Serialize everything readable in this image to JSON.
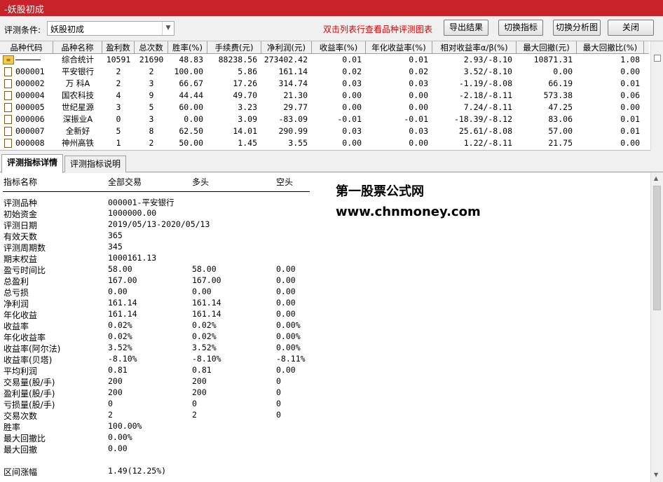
{
  "window": {
    "title": "-妖股初成"
  },
  "toolbar": {
    "condition_label": "评测条件:",
    "condition_value": "妖股初成",
    "hint": "双击列表行查看品种评测图表",
    "export_label": "导出结果",
    "switch_indicator_label": "切换指标",
    "switch_chart_label": "切换分析图",
    "close_label": "关闭"
  },
  "table": {
    "headers": [
      "品种代码",
      "品种名称",
      "盈利数",
      "总次数",
      "胜率(%)",
      "手续费(元)",
      "净利润(元)",
      "收益率(%)",
      "年化收益率(%)",
      "相对收益率α/β(%)",
      "最大回撤(元)",
      "最大回撤比(%)"
    ],
    "rows": [
      [
        "",
        "综合统计",
        "10591",
        "21690",
        "48.83",
        "88238.56",
        "273402.42",
        "0.01",
        "0.01",
        "2.93/-8.10",
        "10871.31",
        "1.08"
      ],
      [
        "000001",
        "平安银行",
        "2",
        "2",
        "100.00",
        "5.86",
        "161.14",
        "0.02",
        "0.02",
        "3.52/-8.10",
        "0.00",
        "0.00"
      ],
      [
        "000002",
        "万 科A",
        "2",
        "3",
        "66.67",
        "17.26",
        "314.74",
        "0.03",
        "0.03",
        "-1.19/-8.08",
        "66.19",
        "0.01"
      ],
      [
        "000004",
        "国农科技",
        "4",
        "9",
        "44.44",
        "49.70",
        "21.30",
        "0.00",
        "0.00",
        "-2.18/-8.11",
        "573.38",
        "0.06"
      ],
      [
        "000005",
        "世纪星源",
        "3",
        "5",
        "60.00",
        "3.23",
        "29.77",
        "0.00",
        "0.00",
        "7.24/-8.11",
        "47.25",
        "0.00"
      ],
      [
        "000006",
        "深振业A",
        "0",
        "3",
        "0.00",
        "3.09",
        "-83.09",
        "-0.01",
        "-0.01",
        "-18.39/-8.12",
        "83.06",
        "0.01"
      ],
      [
        "000007",
        "全新好",
        "5",
        "8",
        "62.50",
        "14.01",
        "290.99",
        "0.03",
        "0.03",
        "25.61/-8.08",
        "57.00",
        "0.01"
      ],
      [
        "000008",
        "神州高铁",
        "1",
        "2",
        "50.00",
        "1.45",
        "3.55",
        "0.00",
        "0.00",
        "1.22/-8.11",
        "21.75",
        "0.00"
      ]
    ]
  },
  "tabs": {
    "detail": "评测指标详情",
    "explain": "评测指标说明"
  },
  "detail": {
    "headers": {
      "name": "指标名称",
      "all": "全部交易",
      "long": "多头",
      "short": "空头"
    },
    "items": [
      {
        "label": "评测品种",
        "all": "000001-平安银行",
        "long": "",
        "short": ""
      },
      {
        "label": "初始资金",
        "all": "1000000.00",
        "long": "",
        "short": ""
      },
      {
        "label": "评测日期",
        "all": "2019/05/13-2020/05/13",
        "long": "",
        "short": ""
      },
      {
        "label": "有效天数",
        "all": "365",
        "long": "",
        "short": ""
      },
      {
        "label": "评测周期数",
        "all": "345",
        "long": "",
        "short": ""
      },
      {
        "label": "期末权益",
        "all": "1000161.13",
        "long": "",
        "short": ""
      },
      {
        "label": "盈亏时间比",
        "all": "58.00",
        "long": "58.00",
        "short": "0.00"
      },
      {
        "label": "总盈利",
        "all": "167.00",
        "long": "167.00",
        "short": "0.00"
      },
      {
        "label": "总亏损",
        "all": "0.00",
        "long": "0.00",
        "short": "0.00"
      },
      {
        "label": "净利润",
        "all": "161.14",
        "long": "161.14",
        "short": "0.00"
      },
      {
        "label": "年化收益",
        "all": "161.14",
        "long": "161.14",
        "short": "0.00"
      },
      {
        "label": "收益率",
        "all": "0.02%",
        "long": "0.02%",
        "short": "0.00%"
      },
      {
        "label": "年化收益率",
        "all": "0.02%",
        "long": "0.02%",
        "short": "0.00%"
      },
      {
        "label": "收益率(阿尔法)",
        "all": "3.52%",
        "long": "3.52%",
        "short": "0.00%"
      },
      {
        "label": "收益率(贝塔)",
        "all": "-8.10%",
        "long": "-8.10%",
        "short": "-8.11%"
      },
      {
        "label": "平均利润",
        "all": "0.81",
        "long": "0.81",
        "short": "0.00"
      },
      {
        "label": "交易量(股/手)",
        "all": "200",
        "long": "200",
        "short": "0"
      },
      {
        "label": "盈利量(股/手)",
        "all": "200",
        "long": "200",
        "short": "0"
      },
      {
        "label": "亏损量(股/手)",
        "all": "0",
        "long": "0",
        "short": "0"
      },
      {
        "label": "交易次数",
        "all": "2",
        "long": "2",
        "short": "0"
      },
      {
        "label": "胜率",
        "all": "100.00%",
        "long": "",
        "short": ""
      },
      {
        "label": "最大回撤比",
        "all": "0.00%",
        "long": "",
        "short": ""
      },
      {
        "label": "最大回撤",
        "all": "0.00",
        "long": "",
        "short": ""
      },
      {
        "label": "",
        "all": "",
        "long": "",
        "short": ""
      },
      {
        "label": "区间涨幅",
        "all": "1.49(12.25%)",
        "long": "",
        "short": ""
      }
    ]
  },
  "brand": {
    "name": "第一股票公式网",
    "url": "www.chnmoney.com"
  }
}
